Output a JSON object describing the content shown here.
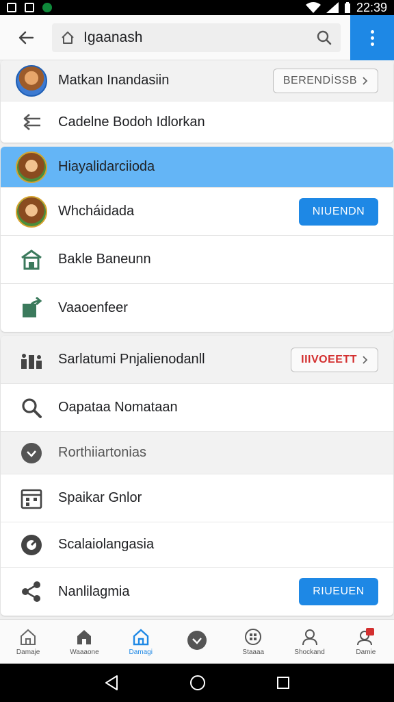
{
  "status_bar": {
    "time": "22:39"
  },
  "search": {
    "value": "Igaanash"
  },
  "sections": {
    "top_card": [
      {
        "label": "Matkan Inandasiin",
        "icon": "profile-avatar",
        "button": "BERENDİSSB"
      },
      {
        "label": "Cadelne Bodoh Idlorkan",
        "icon": "arrows-icon"
      }
    ],
    "second_card": [
      {
        "label": "Hiayalidarciioda",
        "icon": "monkey-avatar"
      },
      {
        "label": "Whcháidada",
        "icon": "monkey-avatar",
        "button": "NIUENDN"
      },
      {
        "label": "Bakle Baneunn",
        "icon": "home-icon"
      },
      {
        "label": "Vaaoenfeer",
        "icon": "share-icon"
      }
    ],
    "third_card": [
      {
        "label": "Sarlatumi Pnjalienodanll",
        "icon": "chart-icon",
        "button": "IIIVOEETT"
      },
      {
        "label": "Oapataa Nomataan",
        "icon": "search-icon"
      },
      {
        "label": "Rorthiiartonias",
        "icon": "check-circle-icon"
      },
      {
        "label": "Spaikar Gnlor",
        "icon": "calendar-icon"
      },
      {
        "label": "Scalaiolangasia",
        "icon": "gauge-icon"
      },
      {
        "label": "Nanlilagmia",
        "icon": "share-nodes-icon",
        "button": "RIUEUEN"
      }
    ]
  },
  "bottom_nav": [
    {
      "label": "Damaje"
    },
    {
      "label": "Waaaone"
    },
    {
      "label": "Damagi"
    },
    {
      "label": ""
    },
    {
      "label": "Staaaa"
    },
    {
      "label": "Shockand"
    },
    {
      "label": "Damie"
    }
  ],
  "colors": {
    "accent": "#1e88e5",
    "selected_row": "#64b5f6",
    "badge_red": "#d32f2f"
  }
}
